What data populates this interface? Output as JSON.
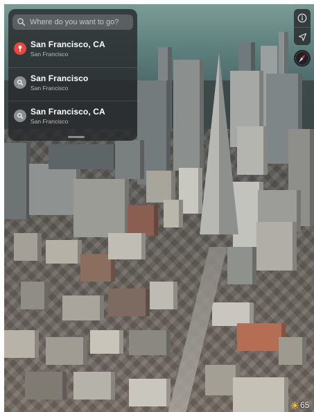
{
  "search": {
    "placeholder": "Where do you want to go?"
  },
  "results": [
    {
      "title": "San Francisco, CA",
      "subtitle": "San Francisco",
      "icon": "pin-icon",
      "color": "#e8473e"
    },
    {
      "title": "San Francisco",
      "subtitle": "San Francisco",
      "icon": "magnifier-icon",
      "color": "#8c8e90"
    },
    {
      "title": "San Francisco, CA",
      "subtitle": "San Francisco",
      "icon": "magnifier-icon",
      "color": "#8c8e90"
    }
  ],
  "controls": {
    "info_icon": "info-icon",
    "location_icon": "location-arrow-icon",
    "compass_icon": "compass-icon"
  },
  "weather": {
    "temperature": "65",
    "icon": "sun-icon",
    "icon_color": "#f3c21b"
  }
}
